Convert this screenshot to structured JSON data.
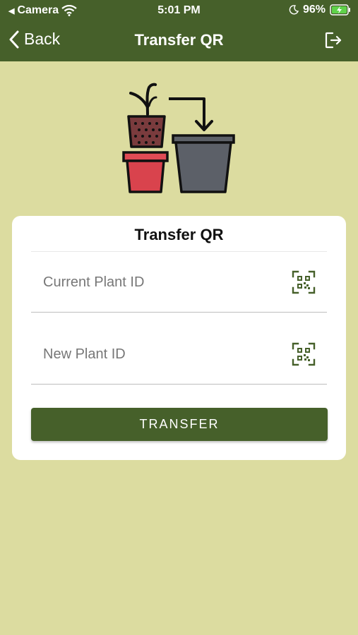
{
  "status_bar": {
    "back_app": "Camera",
    "time": "5:01 PM",
    "battery": "96%"
  },
  "nav": {
    "back_label": "Back",
    "title": "Transfer QR"
  },
  "card": {
    "title": "Transfer QR",
    "current_plant_placeholder": "Current Plant ID",
    "new_plant_placeholder": "New Plant ID",
    "transfer_label": "TRANSFER"
  },
  "colors": {
    "header": "#46602a",
    "background": "#dcdca0",
    "button": "#46602a"
  },
  "icons": {
    "back": "chevron-left-icon",
    "logout": "logout-icon",
    "scan": "qr-code-icon"
  }
}
